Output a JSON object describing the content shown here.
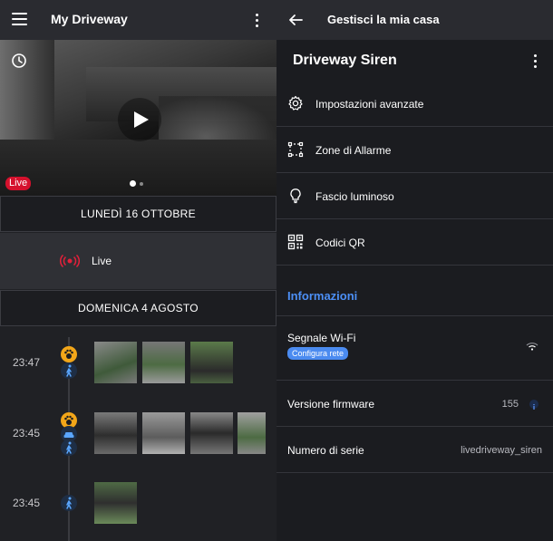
{
  "left": {
    "title": "My Driveway",
    "live_badge": "Live",
    "date_monday": "LUNEDÌ 16 OTTOBRE",
    "live_label": "Live",
    "date_sunday": "DOMENICA 4 AGOSTO",
    "events": [
      {
        "time": "23:47",
        "icons": [
          "paw-icon",
          "person-walking-icon"
        ]
      },
      {
        "time": "23:45",
        "icons": [
          "paw-icon",
          "car-icon",
          "person-walking-icon"
        ]
      },
      {
        "time": "23:45",
        "icons": [
          "person-walking-icon"
        ]
      }
    ]
  },
  "right": {
    "title": "Gestisci la mia casa",
    "device_title": "Driveway Siren",
    "menu": [
      {
        "label": "Impostazioni avanzate",
        "icon": "gear-icon"
      },
      {
        "label": "Zone di Allarme",
        "icon": "zone-icon"
      },
      {
        "label": "Fascio luminoso",
        "icon": "lightbulb-icon"
      },
      {
        "label": "Codici QR",
        "icon": "qr-code-icon"
      }
    ],
    "info_heading": "Informazioni",
    "wifi_label": "Segnale Wi-Fi",
    "config_button": "Configura rete",
    "firmware_label": "Versione firmware",
    "firmware_value": "155",
    "serial_label": "Numero di serie",
    "serial_value": "livedriveway_siren"
  },
  "colors": {
    "accent_blue": "#4b8bf0",
    "live_red": "#d5112d",
    "paw_orange": "#f2a619"
  }
}
